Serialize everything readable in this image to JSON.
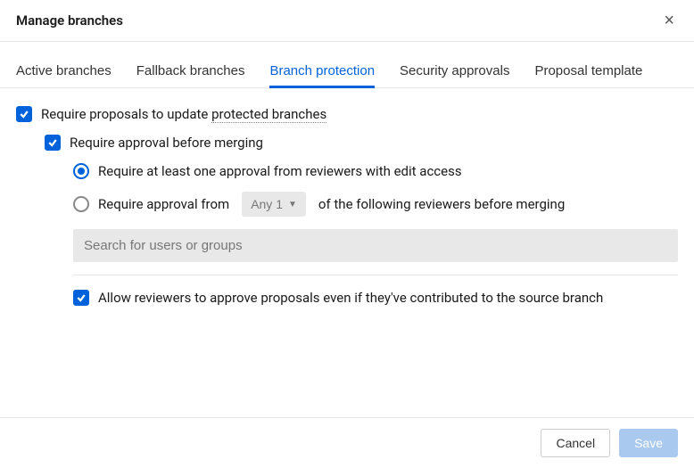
{
  "dialog": {
    "title": "Manage branches"
  },
  "tabs": {
    "active_branches": "Active branches",
    "fallback_branches": "Fallback branches",
    "branch_protection": "Branch protection",
    "security_approvals": "Security approvals",
    "proposal_template": "Proposal template"
  },
  "options": {
    "require_proposals_prefix": "Require proposals to update ",
    "require_proposals_underlined": "protected branches",
    "require_approval": "Require approval before merging",
    "require_one_reviewer": "Require at least one approval from reviewers with edit access",
    "require_from_prefix": "Require approval from",
    "require_from_suffix": "of the following reviewers before merging",
    "select_label": "Any 1",
    "search_placeholder": "Search for users or groups",
    "allow_contributors": "Allow reviewers to approve proposals even if they've contributed to the source branch"
  },
  "footer": {
    "cancel": "Cancel",
    "save": "Save"
  }
}
